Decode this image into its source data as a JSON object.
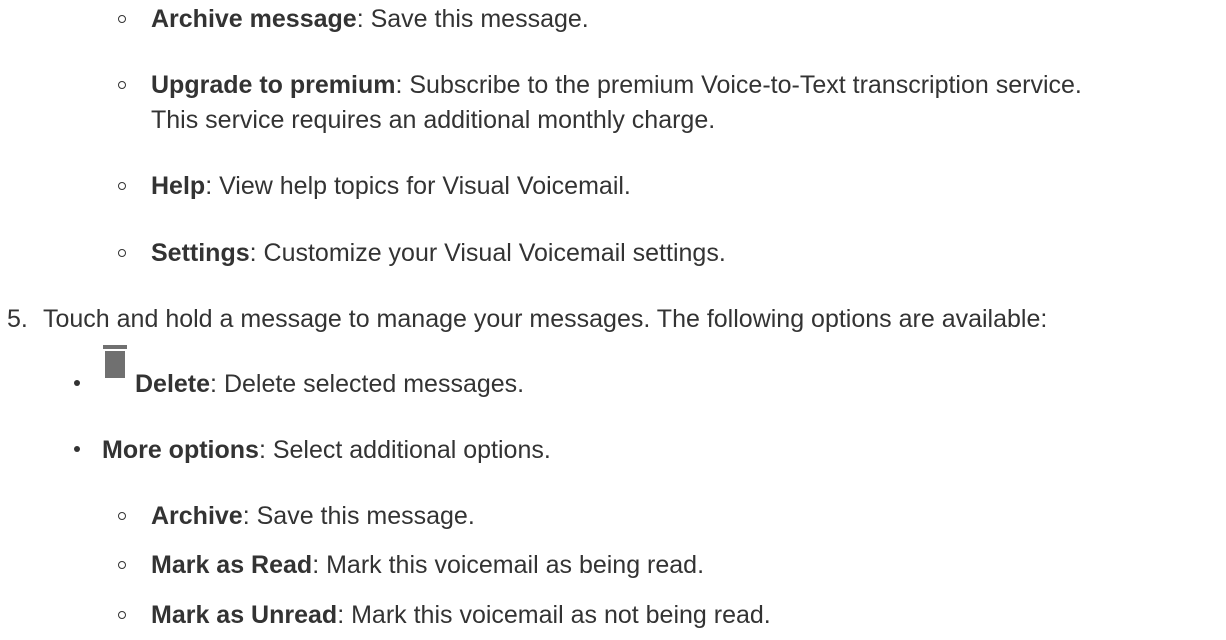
{
  "items": [
    {
      "term": "Archive message",
      "desc": ": Save this message."
    },
    {
      "term": "Upgrade to premium",
      "desc": ": Subscribe to the premium Voice-to-Text transcription service.",
      "desc2": "This service requires an additional monthly charge."
    },
    {
      "term": "Help",
      "desc": ": View help topics for Visual Voicemail."
    },
    {
      "term": "Settings",
      "desc": ": Customize your Visual Voicemail settings."
    }
  ],
  "step5": {
    "number": "5.",
    "text": "Touch and hold a message to manage your messages. The following options are available:"
  },
  "options": [
    {
      "term": "Delete",
      "desc": ": Delete selected messages.",
      "icon": "trash-icon"
    },
    {
      "term": "More options",
      "desc": ": Select additional options."
    }
  ],
  "more_items": [
    {
      "term": "Archive",
      "desc": ": Save this message."
    },
    {
      "term": "Mark as Read",
      "desc": ": Mark this voicemail as being read."
    },
    {
      "term": "Mark as Unread",
      "desc": ": Mark this voicemail as not being read."
    }
  ],
  "colors": {
    "text": "#333333",
    "icon": "#707070"
  }
}
